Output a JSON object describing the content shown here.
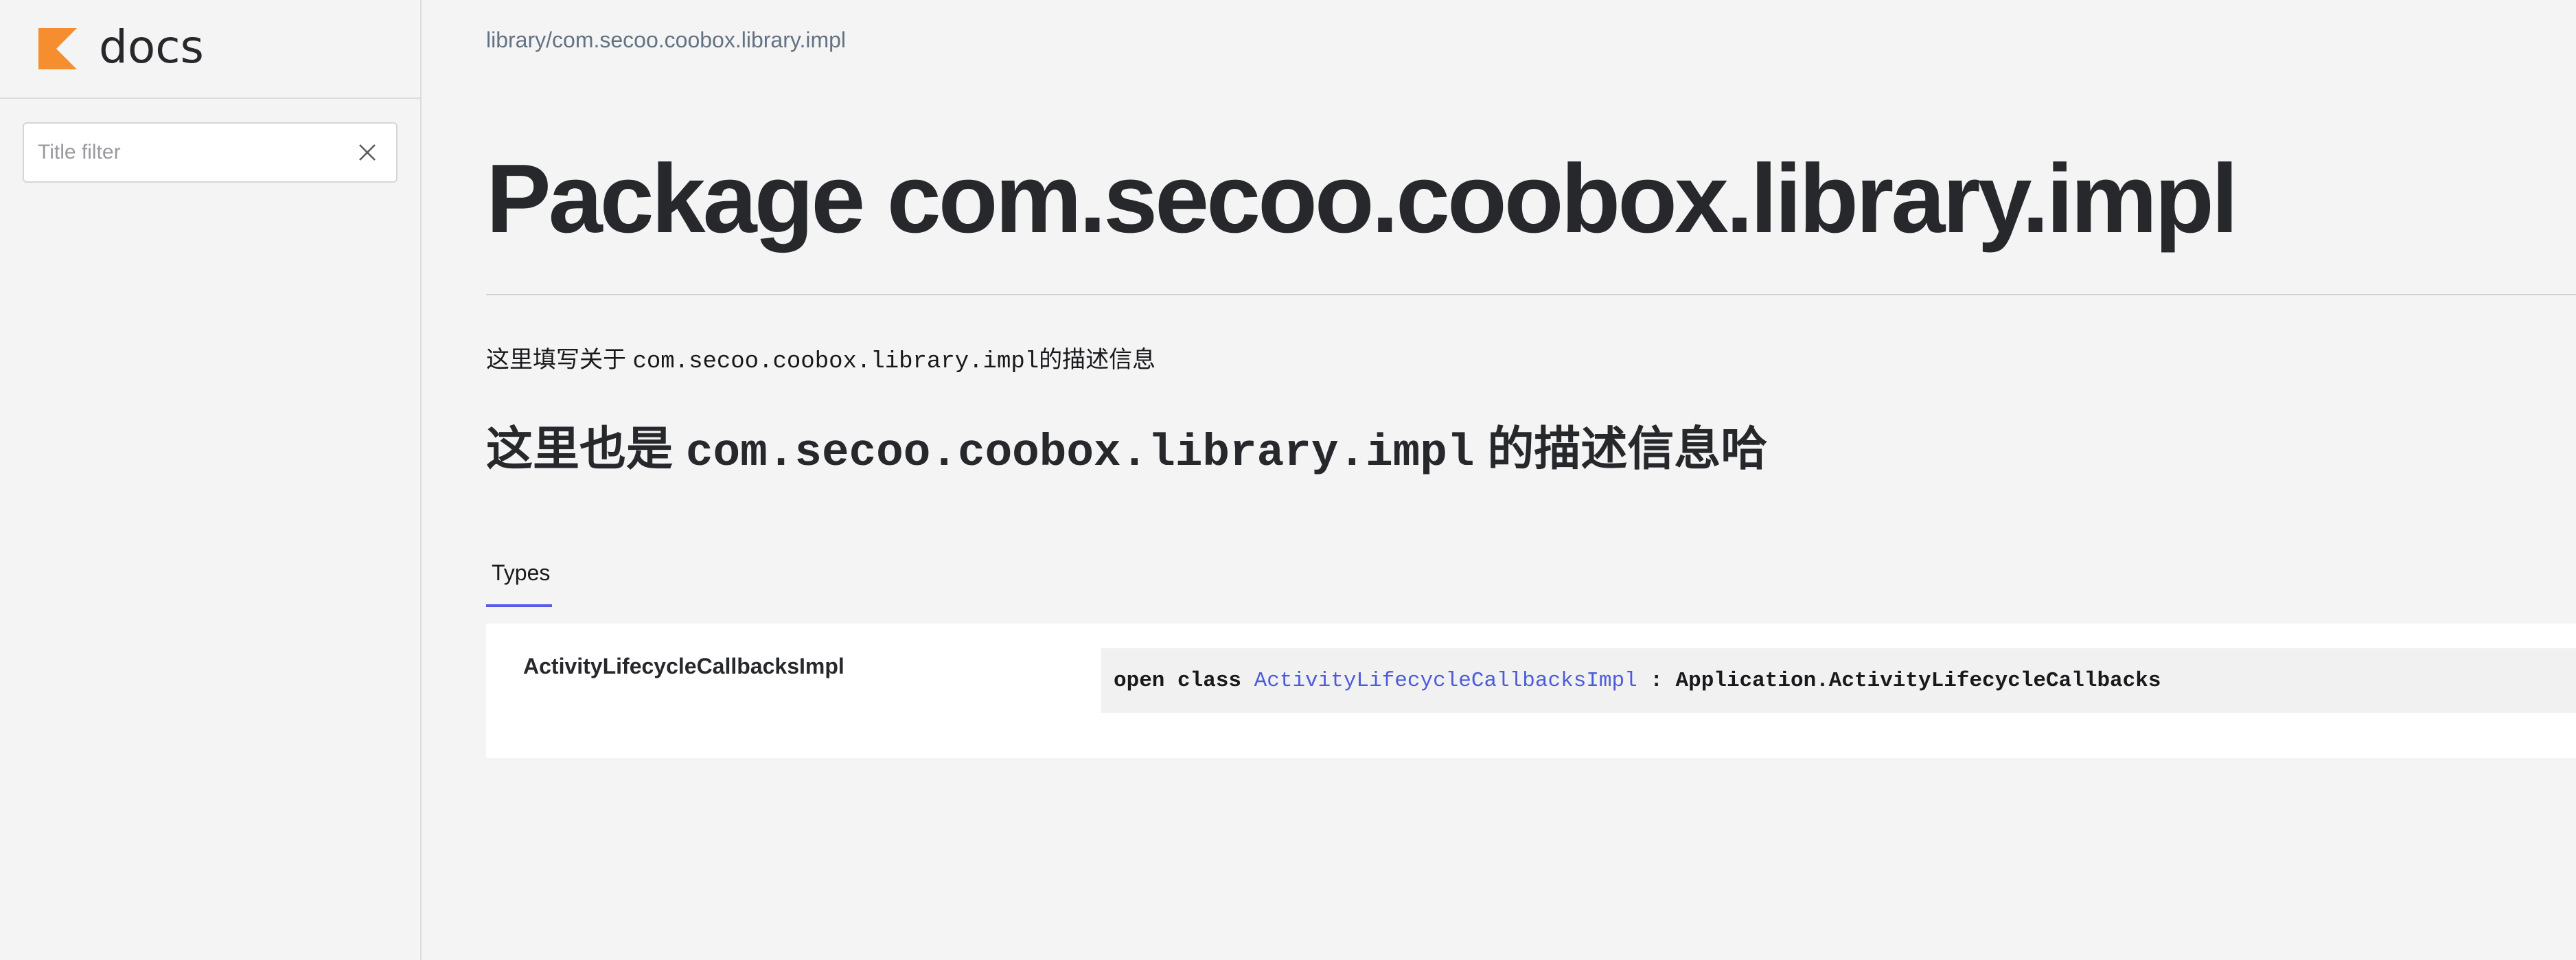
{
  "logo": {
    "text": "docs",
    "accent": "#f68d2e"
  },
  "sidebar": {
    "filter_placeholder": "Title filter",
    "filter_value": ""
  },
  "breadcrumb": "library/com.secoo.coobox.library.impl",
  "title": "Package com.secoo.coobox.library.impl",
  "description": {
    "prefix": "这里填写关于 ",
    "code": "com.secoo.coobox.library.impl",
    "suffix": "的描述信息"
  },
  "subheading": {
    "prefix": "这里也是 ",
    "code": "com.secoo.coobox.library.impl",
    "suffix": " 的描述信息哈"
  },
  "tabs": [
    {
      "label": "Types",
      "active": true
    }
  ],
  "types": [
    {
      "name": "ActivityLifecycleCallbacksImpl",
      "signature": {
        "keywords": "open class ",
        "link": "ActivityLifecycleCallbacksImpl",
        "rest": " : Application.ActivityLifecycleCallbacks"
      }
    }
  ],
  "colors": {
    "link": "#4d5bdb",
    "tab_underline": "#5a5ae8",
    "background": "#f4f4f4"
  }
}
